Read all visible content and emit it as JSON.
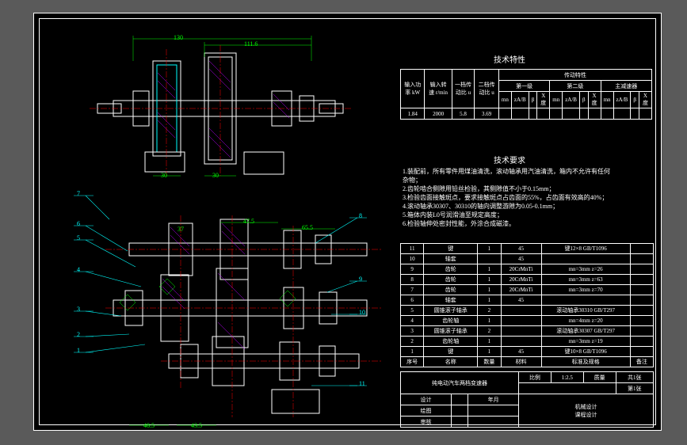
{
  "title_block": {
    "drawing_title": "纯电动汽车两档变速器",
    "scale_label": "比例",
    "scale": "1:2.5",
    "mass_label": "质量",
    "sheet_label": "共1张",
    "sheet2": "第1张",
    "design_label": "设计",
    "check_label": "绘图",
    "approve_label": "审核",
    "date_label": "年月",
    "org1": "机械设计",
    "org2": "课程设计"
  },
  "tech_char": {
    "heading": "技术特性",
    "h_input_power": "输入功率\nkW",
    "h_input_speed": "输入转速\nr/min",
    "h_ratio1": "一档传动比\nu",
    "h_ratio2": "二档传动比\nu",
    "h_trans": "传动特性",
    "h_stage1": "第一级",
    "h_stage2": "第二级",
    "h_main": "主减速器",
    "sub1": "mn",
    "sub2": "zA/B",
    "sub3": "β",
    "sub4": "X度",
    "v_power": "1.84",
    "v_speed": "2000",
    "v_r1": "5.8",
    "v_r2": "3.69"
  },
  "tech_req": {
    "heading": "技术要求",
    "l1": "1.装配前，所有零件用煤油清洗，滚动轴承用汽油清洗，箱内不允许有任何",
    "l1b": "  杂物；",
    "l2": "2.齿轮啮合侧隙用铅丝检验，其侧隙值不小于0.15mm；",
    "l3": "3.检验齿面接触斑点，要求接触斑点占齿面的55%，占齿面有效高的40%；",
    "l4": "4.滚动轴承30307、30310的轴向调整游隙为0.05-0.1mm；",
    "l5": "5.箱体内装L0号润滑油至规定高度；",
    "l6": "6.检验轴伸处密封性能，外涂合成磁漆。"
  },
  "bom": {
    "h_no": "序号",
    "h_name": "名称",
    "h_qty": "数量",
    "h_mat": "材料",
    "h_std": "标准及规格",
    "h_note": "备注",
    "r11": {
      "no": "11",
      "name": "键",
      "qty": "1",
      "mat": "45",
      "std": "键12×8 GB/T1096"
    },
    "r10": {
      "no": "10",
      "name": "轴套",
      "qty": "",
      "mat": "45",
      "std": ""
    },
    "r9": {
      "no": "9",
      "name": "齿轮",
      "qty": "1",
      "mat": "20CrMnTi",
      "std": "mn=3mm  z=26"
    },
    "r8": {
      "no": "8",
      "name": "齿轮",
      "qty": "1",
      "mat": "20CrMnTi",
      "std": "mn=3mm  z=63"
    },
    "r7": {
      "no": "7",
      "name": "齿轮",
      "qty": "1",
      "mat": "20CrMnTi",
      "std": "mn=3mm  z=70"
    },
    "r6": {
      "no": "6",
      "name": "轴套",
      "qty": "1",
      "mat": "45",
      "std": ""
    },
    "r5": {
      "no": "5",
      "name": "圆锥滚子轴承",
      "qty": "2",
      "mat": "",
      "std": "滚动轴承30310 GB/T297"
    },
    "r4": {
      "no": "4",
      "name": "齿轮轴",
      "qty": "1",
      "mat": "",
      "std": "mn=4mm  z=20"
    },
    "r3": {
      "no": "3",
      "name": "圆锥滚子轴承",
      "qty": "2",
      "mat": "",
      "std": "滚动轴承30307 GB/T297"
    },
    "r2": {
      "no": "2",
      "name": "齿轮轴",
      "qty": "1",
      "mat": "",
      "std": "mn=3mm  z=19"
    },
    "r1": {
      "no": "1",
      "name": "键",
      "qty": "1",
      "mat": "45",
      "std": "键10×8 GB/T1096"
    }
  },
  "callouts": {
    "c1": "1",
    "c2": "2",
    "c3": "3",
    "c4": "4",
    "c5": "5",
    "c6": "6",
    "c7": "7",
    "c8": "8",
    "c9": "9",
    "c10": "10",
    "c11": "11"
  },
  "dims": {
    "d1": "130",
    "d2": "111.6",
    "d3": "30",
    "d4": "30",
    "d5": "37",
    "d6": "47.5",
    "d7": "65.5",
    "d8": "48.5",
    "d9": "43.5"
  }
}
